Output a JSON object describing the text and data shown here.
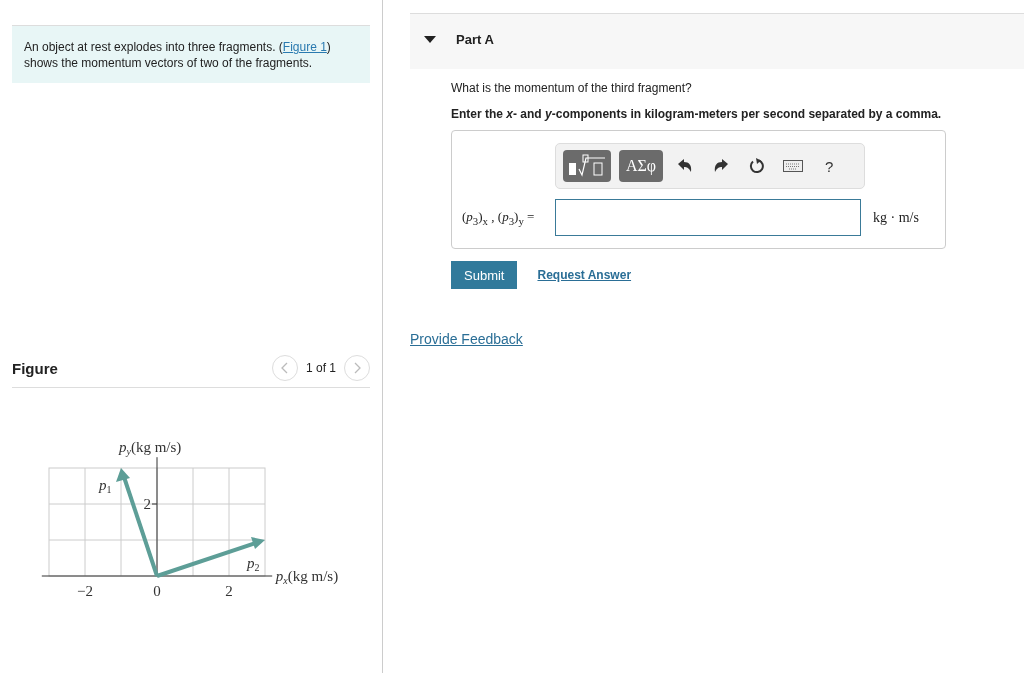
{
  "problem": {
    "text": "An object at rest explodes into three fragments. (",
    "link": "Figure 1",
    "text_after": ") shows the momentum vectors of two of the fragments."
  },
  "figure": {
    "title": "Figure",
    "pager": "1 of 1",
    "diagram": {
      "y_axis_symbol": "p",
      "y_axis_sub": "y",
      "y_axis_unit": "(kg m/s)",
      "x_axis_symbol": "p",
      "x_axis_sub": "x",
      "x_axis_unit": "(kg m/s)",
      "x_ticks": [
        "−2",
        "0",
        "2"
      ],
      "y_tick": "2",
      "vectors": [
        {
          "symbol": "p",
          "sub": "1"
        },
        {
          "symbol": "p",
          "sub": "2"
        }
      ]
    }
  },
  "part": {
    "title": "Part A",
    "expanded": true,
    "question": "What is the momentum of the third fragment?",
    "instruction": "Enter the *x*- and *y*-components in kilogram-meters per second separated by a comma.",
    "toolbar": {
      "greek": "ΑΣφ",
      "help": "?"
    },
    "answer_label": "(*p*$_{3}$)$_{x}$ , (*p*$_{3}$)$_{y}$ =",
    "units": "kg · m/s",
    "submit": "Submit",
    "request": "Request Answer"
  },
  "feedback": "Provide Feedback"
}
